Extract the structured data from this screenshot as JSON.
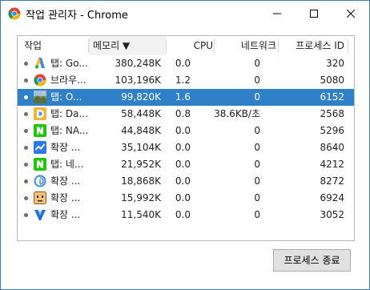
{
  "window": {
    "title": "작업 관리자 - Chrome",
    "minimize_symbol": "—",
    "maximize_symbol": "☐",
    "close_symbol": "✕"
  },
  "columns": {
    "task": "작업",
    "memory": "메모리 ▼",
    "cpu": "CPU",
    "network": "네트워크",
    "pid": "프로세스 ID"
  },
  "rows": [
    {
      "icon": "google-ads-icon",
      "name": "탭: Go...",
      "memory": "380,248K",
      "cpu": "0.0",
      "network": "0",
      "pid": "320",
      "selected": false
    },
    {
      "icon": "chrome-icon",
      "name": "브라우...",
      "memory": "103,196K",
      "cpu": "1.2",
      "network": "0",
      "pid": "5080",
      "selected": false
    },
    {
      "icon": "landscape-photo-icon",
      "name": "탭: O...",
      "memory": "99,820K",
      "cpu": "1.6",
      "network": "0",
      "pid": "6152",
      "selected": true
    },
    {
      "icon": "d-letter-icon",
      "name": "탭: Da...",
      "memory": "58,448K",
      "cpu": "0.8",
      "network": "38.6KB/초",
      "pid": "2568",
      "selected": false
    },
    {
      "icon": "naver-n-icon",
      "name": "탭: NA...",
      "memory": "44,848K",
      "cpu": "0.0",
      "network": "0",
      "pid": "5296",
      "selected": false
    },
    {
      "icon": "chart-line-icon",
      "name": "확장 ...",
      "memory": "35,104K",
      "cpu": "0.0",
      "network": "0",
      "pid": "8640",
      "selected": false
    },
    {
      "icon": "naver-n-icon",
      "name": "탭: 네...",
      "memory": "21,952K",
      "cpu": "0.0",
      "network": "0",
      "pid": "4212",
      "selected": false
    },
    {
      "icon": "blue-circle-i-icon",
      "name": "확장 ...",
      "memory": "18,868K",
      "cpu": "0.0",
      "network": "0",
      "pid": "8272",
      "selected": false
    },
    {
      "icon": "face-box-icon",
      "name": "확장 ...",
      "memory": "15,992K",
      "cpu": "0.0",
      "network": "0",
      "pid": "6924",
      "selected": false
    },
    {
      "icon": "v-shield-icon",
      "name": "확장 ...",
      "memory": "11,540K",
      "cpu": "0.0",
      "network": "0",
      "pid": "3052",
      "selected": false
    }
  ],
  "end_process_button": "프로세스 종료",
  "colors": {
    "selection": "#2f80c8",
    "border": "#3c78c0"
  }
}
